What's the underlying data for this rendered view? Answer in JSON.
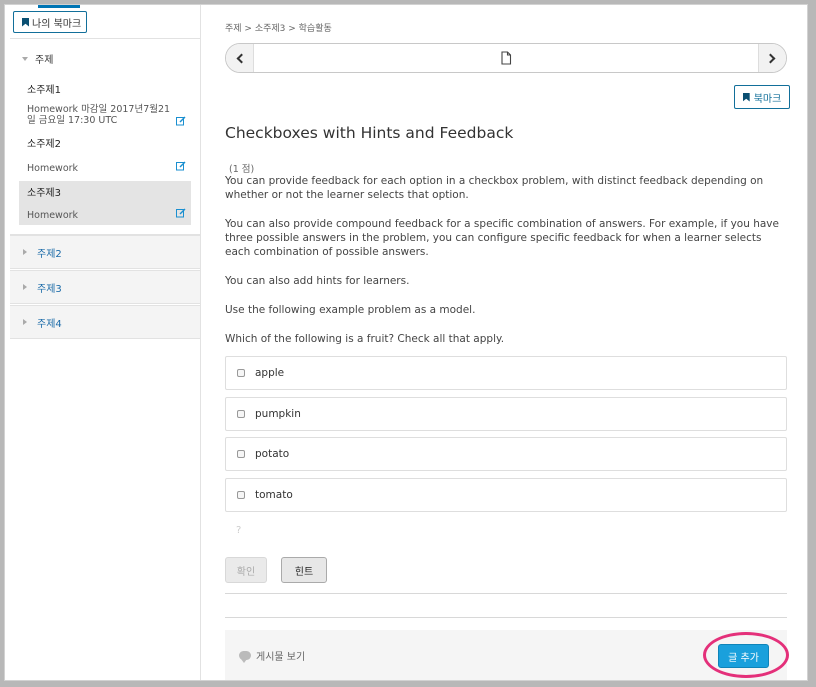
{
  "sidebar": {
    "bookmark_button": "나의 북마크",
    "chapter_expanded": "주제",
    "subsections": [
      {
        "title": "소주제1",
        "detail": "Homework 마감일 2017년7월21일 금요일 17:30 UTC"
      },
      {
        "title": "소주제2",
        "detail": "Homework"
      },
      {
        "title": "소주제3",
        "detail": "Homework"
      }
    ],
    "chapters_collapsed": [
      "주제2",
      "주제3",
      "주제4"
    ]
  },
  "main": {
    "breadcrumb": "주제 > 소주제3 > 학습활동",
    "bookmark_label": "북마크",
    "problem_title": "Checkboxes with Hints and Feedback",
    "points": "(1 점)",
    "paragraphs": [
      "You can provide feedback for each option in a checkbox problem, with distinct feedback depending on whether or not the learner selects that option.",
      "You can also provide compound feedback for a specific combination of answers. For example, if you have three possible answers in the problem, you can configure specific feedback for when a learner selects each combination of possible answers.",
      "You can also add hints for learners.",
      "Use the following example problem as a model.",
      "Which of the following is a fruit? Check all that apply."
    ],
    "choices": [
      "apple",
      "pumpkin",
      "potato",
      "tomato"
    ],
    "help_mark": "?",
    "submit_label": "확인",
    "hint_label": "힌트",
    "discussion": {
      "show_posts": "게시물 보기",
      "add_post": "글 추가"
    }
  },
  "colors": {
    "accent": "#0075b4",
    "link": "#1a6aa8",
    "add_button": "#1aa0dc",
    "highlight_ring": "#e4307a"
  }
}
